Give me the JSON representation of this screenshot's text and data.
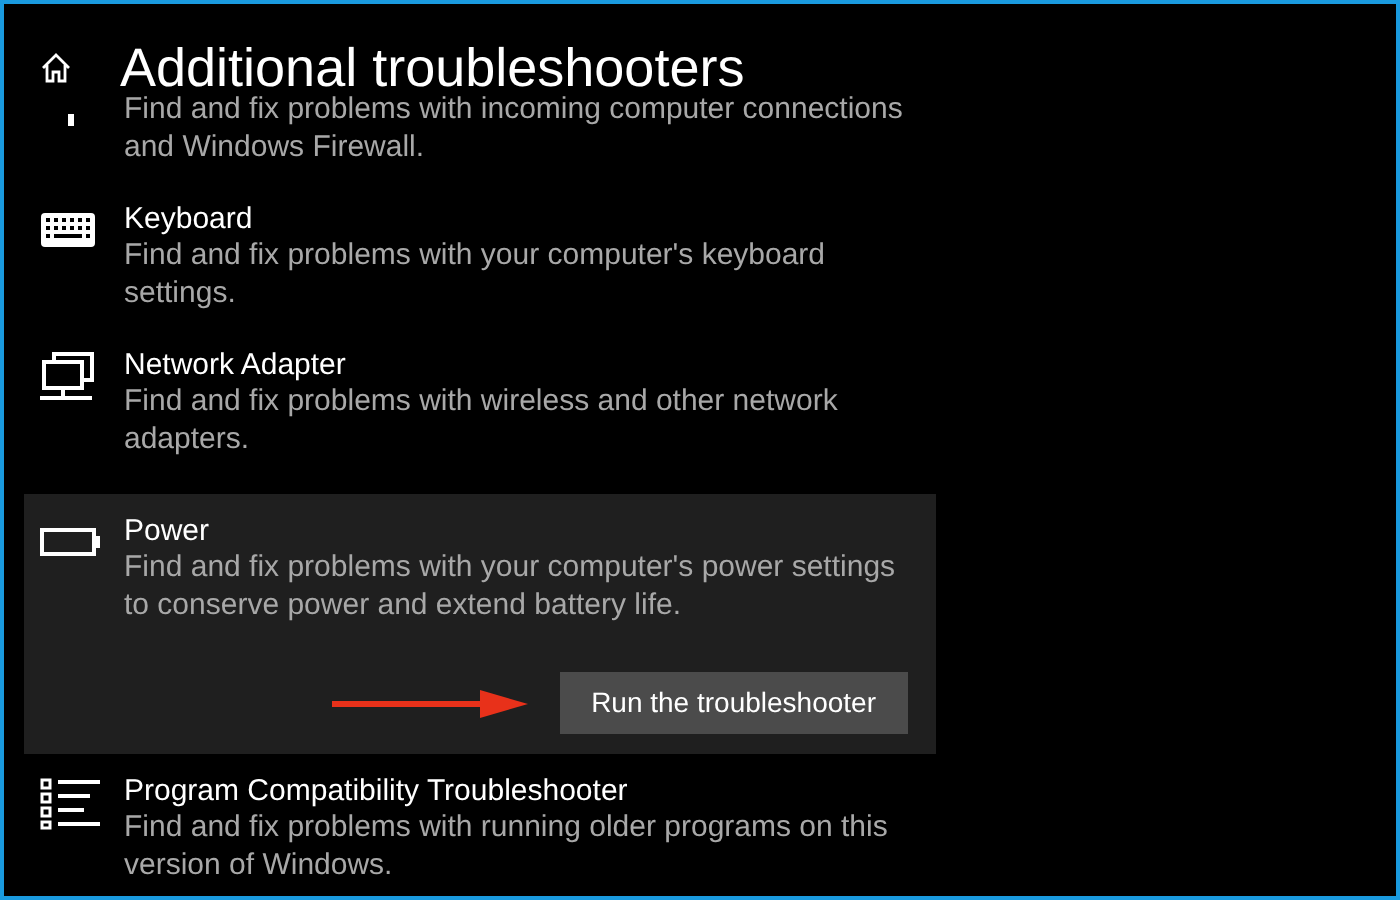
{
  "page": {
    "title": "Additional troubleshooters"
  },
  "troubleshooters": [
    {
      "description": "Find and fix problems with incoming computer connections and Windows Firewall.",
      "expanded": false
    },
    {
      "title": "Keyboard",
      "description": "Find and fix problems with your computer's keyboard settings.",
      "expanded": false
    },
    {
      "title": "Network Adapter",
      "description": "Find and fix problems with wireless and other network adapters.",
      "expanded": false
    },
    {
      "title": "Power",
      "description": "Find and fix problems with your computer's power settings to conserve power and extend battery life.",
      "expanded": true,
      "button": "Run the troubleshooter"
    },
    {
      "title": "Program Compatibility Troubleshooter",
      "description": "Find and fix problems with running older programs on this version of Windows.",
      "expanded": false
    }
  ]
}
